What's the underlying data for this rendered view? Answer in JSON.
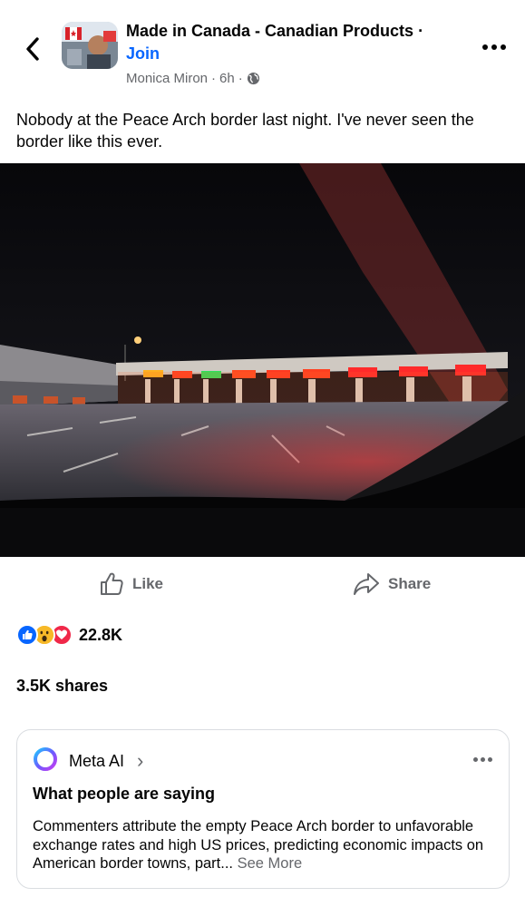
{
  "header": {
    "group_name": "Made in Canada - Canadian Products",
    "separator": " · ",
    "join_label": "Join",
    "author": "Monica Miron",
    "dot": "·",
    "time": "6h",
    "dot2": "·",
    "privacy_icon": "globe-icon",
    "back_icon": "chevron-left-icon",
    "more_icon": "more-horizontal-icon"
  },
  "post": {
    "text": "Nobody at the Peace Arch border last night. I've never seen the border like this ever."
  },
  "actions": {
    "like_label": "Like",
    "share_label": "Share"
  },
  "reactions": {
    "types": [
      "like",
      "wow",
      "love"
    ],
    "count": "22.8K"
  },
  "shares": {
    "label": "3.5K shares"
  },
  "meta_ai": {
    "name": "Meta AI",
    "chevron": "›",
    "title": "What people are saying",
    "body": "Commenters attribute the empty Peace Arch border to unfavorable exchange rates and high US prices, predicting economic impacts on American border towns, part... ",
    "see_more": "See More"
  },
  "colors": {
    "link_blue": "#0866ff",
    "secondary_text": "#65676b",
    "like_blue": "#0866ff",
    "love_red": "#f02849",
    "wow_yellow": "#f7b928"
  }
}
